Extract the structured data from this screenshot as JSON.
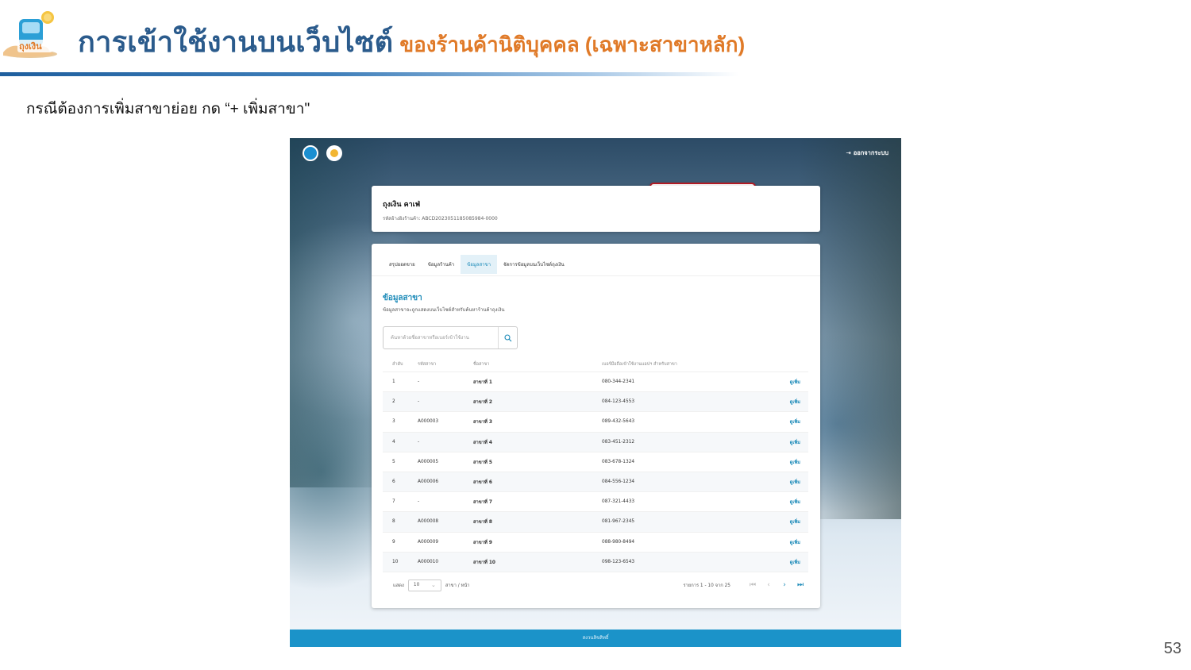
{
  "slide": {
    "title": "การเข้าใช้งานบนเว็บไซต์",
    "subtitle": "ของร้านค้านิติบุคคล (เฉพาะสาขาหลัก)",
    "logo_text": "ถุงเงิน",
    "instruction": "กรณีต้องการเพิ่มสาขาย่อย กด “+ เพิ่มสาขา\"",
    "page_number": "53"
  },
  "app": {
    "logout_label": "ออกจากระบบ",
    "shop": {
      "name": "ถุงเงิน คาเฟ่",
      "code_line": "รหัสอ้างอิงร้านค้า: ABCD2023051185085984-0000"
    },
    "tabs": [
      {
        "label": "สรุปยอดขาย",
        "active": false
      },
      {
        "label": "ข้อมูลร้านค้า",
        "active": false
      },
      {
        "label": "ข้อมูลสาขา",
        "active": true
      },
      {
        "label": "จัดการข้อมูลบนเว็บไซต์ถุงเงิน",
        "active": false
      }
    ],
    "section": {
      "title": "ข้อมูลสาขา",
      "subtitle": "ข้อมูลสาขาจะถูกแสดงบนเว็บไซต์สำหรับค้นหาร้านค้าถุงเงิน"
    },
    "add_branch_label": "+ เพิ่มสาขา",
    "search_placeholder": "ค้นหาด้วยชื่อสาขาหรือเบอร์เข้าใช้งาน",
    "table": {
      "headers": [
        "ลำดับ",
        "รหัสสาขา",
        "ชื่อสาขา",
        "เบอร์มือถือเข้าใช้งานแอปฯ สำหรับสาขา",
        ""
      ],
      "rows": [
        {
          "no": "1",
          "code": "-",
          "name": "สาขาที่ 1",
          "phone": "080-344-2341",
          "action": "ดูเพิ่ม"
        },
        {
          "no": "2",
          "code": "-",
          "name": "สาขาที่ 2",
          "phone": "084-123-4553",
          "action": "ดูเพิ่ม"
        },
        {
          "no": "3",
          "code": "A000003",
          "name": "สาขาที่ 3",
          "phone": "089-432-5643",
          "action": "ดูเพิ่ม"
        },
        {
          "no": "4",
          "code": "-",
          "name": "สาขาที่ 4",
          "phone": "083-451-2312",
          "action": "ดูเพิ่ม"
        },
        {
          "no": "5",
          "code": "A000005",
          "name": "สาขาที่ 5",
          "phone": "083-678-1324",
          "action": "ดูเพิ่ม"
        },
        {
          "no": "6",
          "code": "A000006",
          "name": "สาขาที่ 6",
          "phone": "084-556-1234",
          "action": "ดูเพิ่ม"
        },
        {
          "no": "7",
          "code": "-",
          "name": "สาขาที่ 7",
          "phone": "087-321-4433",
          "action": "ดูเพิ่ม"
        },
        {
          "no": "8",
          "code": "A000008",
          "name": "สาขาที่ 8",
          "phone": "081-967-2345",
          "action": "ดูเพิ่ม"
        },
        {
          "no": "9",
          "code": "A000009",
          "name": "สาขาที่ 9",
          "phone": "088-980-8494",
          "action": "ดูเพิ่ม"
        },
        {
          "no": "10",
          "code": "A000010",
          "name": "สาขาที่ 10",
          "phone": "098-123-6543",
          "action": "ดูเพิ่ม"
        }
      ]
    },
    "pagination": {
      "show_label": "แสดง",
      "page_size": "10",
      "per_page_label": "สาขา / หน้า",
      "range_text": "รายการ 1 - 10 จาก 25",
      "first_icon": "first-page-icon",
      "prev_icon": "chevron-left-icon",
      "next_icon": "chevron-right-icon",
      "last_icon": "last-page-icon"
    },
    "footer_text": "สงวนลิขสิทธิ์"
  },
  "colors": {
    "title_blue": "#2b5b8c",
    "subtitle_orange": "#e07a28",
    "accent": "#1b8ab8",
    "highlight_border": "#b31c25",
    "footer_bar": "#1b93c9"
  }
}
